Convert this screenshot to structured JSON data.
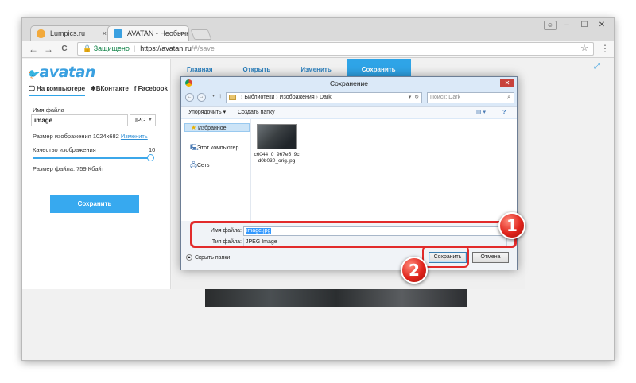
{
  "browser": {
    "tabs": [
      {
        "title": "Lumpics.ru",
        "favicon_color": "#f2a93b"
      },
      {
        "title": "AVATAN - Необычный ф",
        "favicon_color": "#3aa0e0"
      }
    ],
    "tab_close_glyph": "×",
    "window_controls": {
      "profile": "☺",
      "minimize": "–",
      "maximize": "☐",
      "close": "✕"
    },
    "nav": {
      "back": "←",
      "forward": "→",
      "reload": "C"
    },
    "address": {
      "secure_label": "Защищено",
      "host": "https://avatan.ru",
      "path": "/#/save"
    },
    "star_glyph": "☆",
    "menu_glyph": "⋮"
  },
  "app": {
    "logo_text": "avatan",
    "source_tabs": [
      "На компьютере",
      "ВКонтакте",
      "Facebook"
    ],
    "filename_label": "Имя файла",
    "filename_value": "image",
    "format_value": "JPG",
    "image_size_label": "Размер изображения 1024x682",
    "change_link": "Изменить",
    "quality_label": "Качество изображения",
    "quality_value": "10",
    "file_size_label": "Размер файла: 759 Кбайт",
    "save_button": "Сохранить",
    "top_nav": [
      "Главная",
      "Открыть",
      "Изменить",
      "Сохранить"
    ],
    "expand_glyph": "⤢"
  },
  "dialog": {
    "title": "Сохранение",
    "close_glyph": "✕",
    "path_segments": [
      "Библиотеки",
      "Изображения",
      "Dark"
    ],
    "search_placeholder": "Поиск: Dark",
    "organize": "Упорядочить ▾",
    "new_folder": "Создать папку",
    "sidebar": [
      "Избранное",
      "Этот компьютер",
      "Сеть"
    ],
    "file_caption": "c6044_0_967e5_9c d0b030_orig.jpg",
    "filename_label": "Имя файла:",
    "filename_value": "image.jpg",
    "filetype_label": "Тип файла:",
    "filetype_value": "JPEG Image",
    "hide_folders": "Скрыть папки",
    "save_button": "Сохранить",
    "cancel_button": "Отмена"
  },
  "callouts": [
    "1",
    "2"
  ],
  "colors": {
    "accent": "#2fa4e7",
    "callout": "#e22b2b"
  }
}
